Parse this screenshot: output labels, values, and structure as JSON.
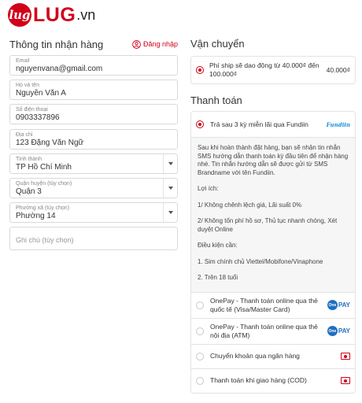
{
  "logo": {
    "mark": "lug",
    "name": "LUG",
    "suffix": ".vn"
  },
  "shipping_info": {
    "title": "Thông tin nhận hàng",
    "login_label": "Đăng nhập",
    "fields": {
      "email": {
        "label": "Email",
        "value": "nguyenvana@gmail.com"
      },
      "name": {
        "label": "Họ và tên",
        "value": "Nguyễn Văn A"
      },
      "phone": {
        "label": "Số điện thoại",
        "value": "0903337896"
      },
      "address": {
        "label": "Địa chỉ",
        "value": "123 Đặng Văn Ngữ"
      },
      "province": {
        "label": "Tỉnh thành",
        "value": "TP Hồ Chí Minh"
      },
      "district": {
        "label": "Quận huyện (tùy chọn)",
        "value": "Quận 3"
      },
      "ward": {
        "label": "Phường xã (tùy chọn)",
        "value": "Phường 14"
      },
      "note": {
        "placeholder": "Ghi chú (tùy chọn)"
      }
    }
  },
  "shipping": {
    "title": "Vận chuyển",
    "option_text": "Phí ship sẽ dao động từ 40.000₫ đến 100.000₫",
    "price": "40.000₫"
  },
  "payment": {
    "title": "Thanh toán",
    "fundiin": {
      "label": "Trả sau 3 kỳ miễn lãi qua Fundiin",
      "logo": "Fundiin",
      "desc": [
        "Sau khi hoàn thành đặt hàng, bạn sẽ nhận tin nhắn SMS hướng dẫn thanh toán kỳ đầu tiên để nhận hàng nhé. Tin nhắn hướng dẫn sẽ được gửi từ SMS Brandname với tên Fundiin.",
        "Lợi ích:",
        "1/ Không chênh lệch giá, Lãi suất 0%",
        "2/ Không tốn phí hồ sơ, Thủ tục nhanh chóng, Xét duyệt Online",
        "Điều kiện cần:",
        "1. Sim chính chủ Viettel/Mobifone/Vinaphone",
        "2. Trên 18 tuổi"
      ]
    },
    "onepay_intl": {
      "label": "OnePay - Thanh toán online qua thẻ quốc tế (Visa/Master Card)",
      "logo_text": "PAY",
      "logo_mark": "One"
    },
    "onepay_domestic": {
      "label": "OnePay - Thanh toán online qua thẻ nội địa (ATM)",
      "logo_text": "PAY",
      "logo_mark": "One"
    },
    "bank_transfer": {
      "label": "Chuyển khoản qua ngân hàng",
      "icon": "bank-transfer-icon"
    },
    "cod": {
      "label": "Thanh toán khi giao hàng (COD)",
      "icon": "cash-icon"
    }
  },
  "colors": {
    "accent": "#d0021b",
    "onepay": "#1f6fc1",
    "fundiin": "#1a8fd8"
  }
}
